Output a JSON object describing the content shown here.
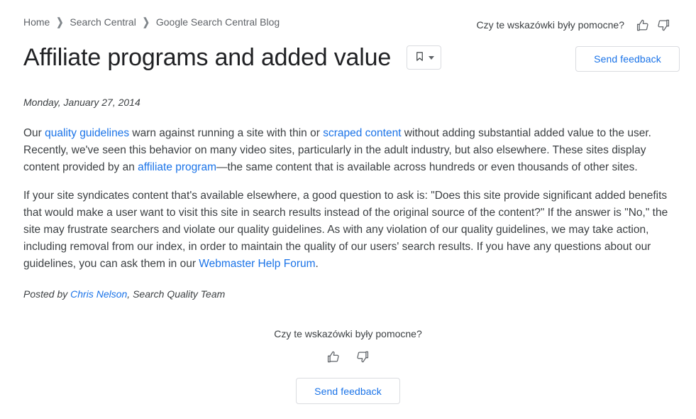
{
  "breadcrumb": {
    "separator": "❯",
    "items": [
      {
        "label": "Home"
      },
      {
        "label": "Search Central"
      },
      {
        "label": "Google Search Central Blog"
      }
    ]
  },
  "header": {
    "title": "Affiliate programs and added value",
    "bookmark_icon": "bookmark-icon",
    "bookmark_caret_icon": "chevron-down-icon"
  },
  "feedback_top": {
    "question": "Czy te wskazówki były pomocne?",
    "thumb_up_icon": "thumb-up-icon",
    "thumb_down_icon": "thumb-down-icon",
    "send_feedback_label": "Send feedback"
  },
  "article": {
    "date": "Monday, January 27, 2014",
    "paragraph1": {
      "t1": "Our ",
      "link1": "quality guidelines",
      "t2": " warn against running a site with thin or ",
      "link2": "scraped content",
      "t3": " without adding substantial added value to the user. Recently, we've seen this behavior on many video sites, particularly in the adult industry, but also elsewhere. These sites display content provided by an ",
      "link3": "affiliate program",
      "t4": "—the same content that is available across hundreds or even thousands of other sites."
    },
    "paragraph2": {
      "t1": "If your site syndicates content that's available elsewhere, a good question to ask is: \"Does this site provide significant added benefits that would make a user want to visit this site in search results instead of the original source of the content?\" If the answer is \"No,\" the site may frustrate searchers and violate our quality guidelines. As with any violation of our quality guidelines, we may take action, including removal from our index, in order to maintain the quality of our users' search results. If you have any questions about our guidelines, you can ask them in our ",
      "link1": "Webmaster Help Forum",
      "t2": "."
    },
    "author": {
      "prefix": "Posted by ",
      "name": "Chris Nelson",
      "suffix": ", Search Quality Team"
    }
  },
  "feedback_bottom": {
    "question": "Czy te wskazówki były pomocne?",
    "thumb_up_icon": "thumb-up-icon",
    "thumb_down_icon": "thumb-down-icon",
    "send_feedback_label": "Send feedback"
  },
  "colors": {
    "link": "#1a73e8",
    "text": "#3c4043",
    "title": "#202124",
    "muted": "#5f6368",
    "border": "#dadce0",
    "background": "#ffffff"
  }
}
